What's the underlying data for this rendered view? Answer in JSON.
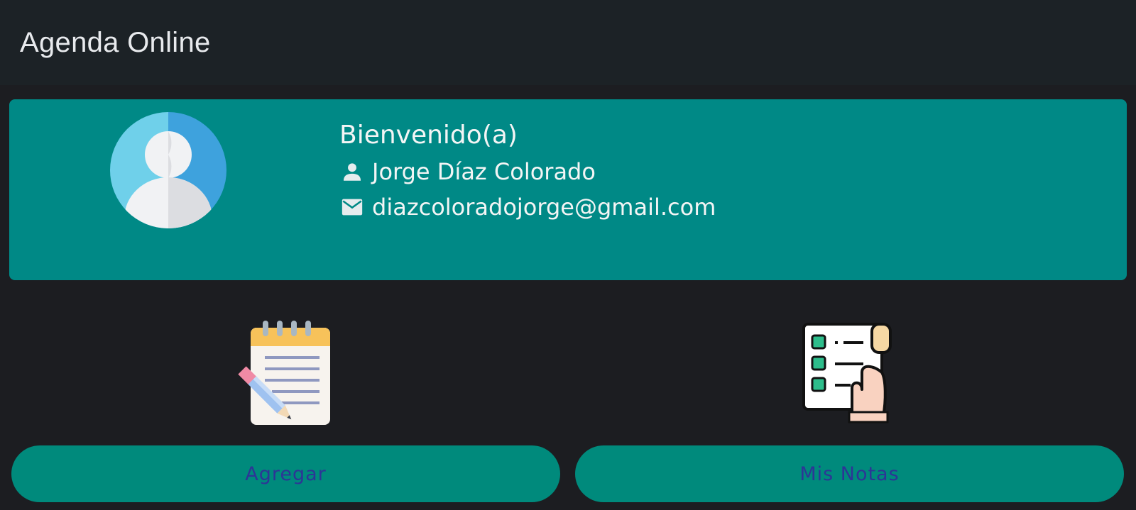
{
  "app_bar": {
    "title": "Agenda Online"
  },
  "profile": {
    "greeting": "Bienvenido(a)",
    "name": "Jorge Díaz Colorado",
    "email": "diazcoloradojorge@gmail.com",
    "avatar_icon": "user-avatar-icon",
    "name_icon": "person-icon",
    "email_icon": "mail-icon"
  },
  "actions": [
    {
      "label": "Agregar",
      "icon": "notepad-icon"
    },
    {
      "label": "Mis Notas",
      "icon": "checklist-icon"
    }
  ],
  "colors": {
    "background": "#1c1d21",
    "app_bar": "#1c2226",
    "card": "#008986",
    "button": "#008a7c",
    "button_text": "#2d3596"
  }
}
